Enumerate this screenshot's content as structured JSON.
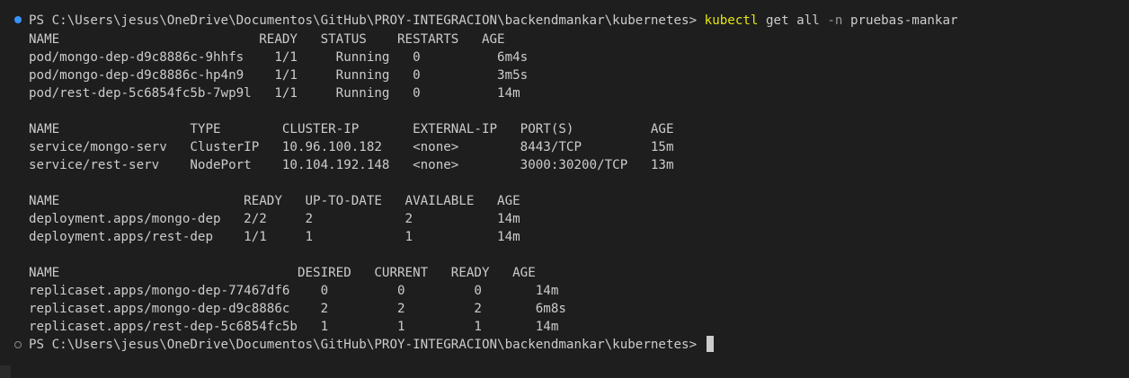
{
  "prompt1": {
    "text": "PS C:\\Users\\jesus\\OneDrive\\Documentos\\GitHub\\PROY-INTEGRACION\\backendmankar\\kubernetes> ",
    "cmd_name": "kubectl",
    "cmd_mid": " get all ",
    "cmd_flag": "-n",
    "cmd_end": " pruebas-mankar"
  },
  "output": [
    {
      "id": "pods-header",
      "text": "NAME                          READY   STATUS    RESTARTS   AGE"
    },
    {
      "id": "pod-row",
      "text": "pod/mongo-dep-d9c8886c-9hhfs    1/1     Running   0          6m4s"
    },
    {
      "id": "pod-row",
      "text": "pod/mongo-dep-d9c8886c-hp4n9    1/1     Running   0          3m5s"
    },
    {
      "id": "pod-row",
      "text": "pod/rest-dep-5c6854fc5b-7wp9l   1/1     Running   0          14m"
    },
    {
      "id": "blank",
      "text": ""
    },
    {
      "id": "services-header",
      "text": "NAME                 TYPE        CLUSTER-IP       EXTERNAL-IP   PORT(S)          AGE"
    },
    {
      "id": "service-row",
      "text": "service/mongo-serv   ClusterIP   10.96.100.182    <none>        8443/TCP         15m"
    },
    {
      "id": "service-row",
      "text": "service/rest-serv    NodePort    10.104.192.148   <none>        3000:30200/TCP   13m"
    },
    {
      "id": "blank",
      "text": ""
    },
    {
      "id": "deployments-header",
      "text": "NAME                        READY   UP-TO-DATE   AVAILABLE   AGE"
    },
    {
      "id": "deployment-row",
      "text": "deployment.apps/mongo-dep   2/2     2            2           14m"
    },
    {
      "id": "deployment-row",
      "text": "deployment.apps/rest-dep    1/1     1            1           14m"
    },
    {
      "id": "blank",
      "text": ""
    },
    {
      "id": "replicasets-header",
      "text": "NAME                               DESIRED   CURRENT   READY   AGE"
    },
    {
      "id": "replicaset-row",
      "text": "replicaset.apps/mongo-dep-77467df6    0         0         0       14m"
    },
    {
      "id": "replicaset-row",
      "text": "replicaset.apps/mongo-dep-d9c8886c    2         2         2       6m8s"
    },
    {
      "id": "replicaset-row",
      "text": "replicaset.apps/rest-dep-5c6854fc5b   1         1         1       14m"
    }
  ],
  "prompt2": {
    "text": "PS C:\\Users\\jesus\\OneDrive\\Documentos\\GitHub\\PROY-INTEGRACION\\backendmankar\\kubernetes> "
  },
  "colors": {
    "background": "#1e1e1e",
    "foreground": "#cccccc",
    "command": "#e5e510",
    "flag": "#999999",
    "success-marker": "#3794ff"
  }
}
